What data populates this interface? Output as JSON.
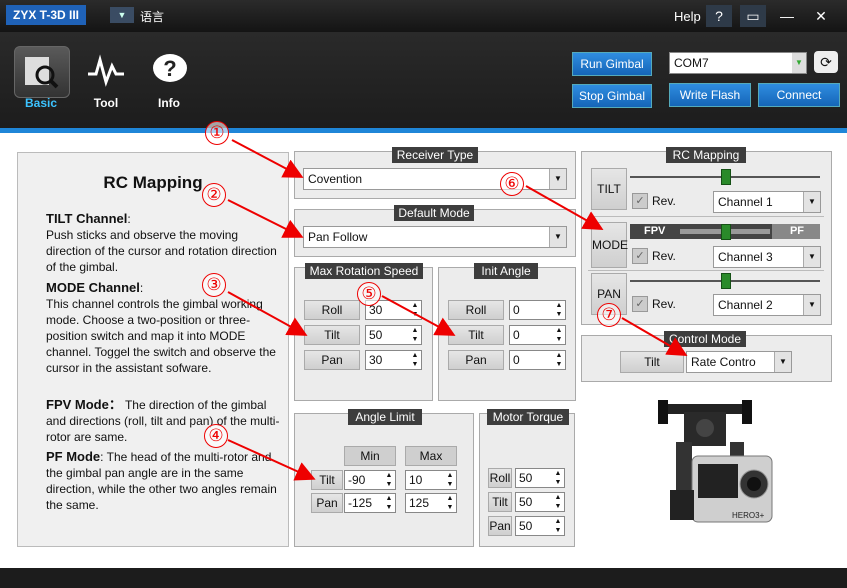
{
  "app": {
    "title": "ZYX T-3D III",
    "language_label": "语言",
    "help_label": "Help"
  },
  "toolbar": {
    "basic": "Basic",
    "tool": "Tool",
    "info": "Info",
    "run_gimbal": "Run Gimbal",
    "stop_gimbal": "Stop Gimbal",
    "write_flash": "Write Flash",
    "connect": "Connect",
    "com_port": "COM7"
  },
  "instructions": {
    "title": "RC Mapping",
    "tilt_head": "TILT Channel",
    "tilt_text": "Push sticks and observe the moving direction of the cursor and rotation direction of the gimbal.",
    "mode_head": "MODE Channel",
    "mode_text": "This channel controls the gimbal working mode. Choose a two-position or three-position switch and map it into MODE channel. Toggel the switch and observe the cursor in the assistant sofware.",
    "fpv_head": "FPV Mode：",
    "fpv_text": "The direction of the gimbal and directions (roll, tilt and pan) of the multi-rotor are same.",
    "pf_head": "PF Mode",
    "pf_text": "The head of the multi-rotor and the gimbal pan angle are in the same direction, while the other two angles remain the same."
  },
  "receiver": {
    "title": "Receiver Type",
    "value": "Covention"
  },
  "default_mode": {
    "title": "Default Mode",
    "value": "Pan Follow"
  },
  "max_speed": {
    "title": "Max Rotation Speed",
    "roll_label": "Roll",
    "roll": "30",
    "tilt_label": "Tilt",
    "tilt": "50",
    "pan_label": "Pan",
    "pan": "30"
  },
  "init_angle": {
    "title": "Init Angle",
    "roll_label": "Roll",
    "roll": "0",
    "tilt_label": "Tilt",
    "tilt": "0",
    "pan_label": "Pan",
    "pan": "0"
  },
  "angle_limit": {
    "title": "Angle Limit",
    "min_label": "Min",
    "max_label": "Max",
    "tilt_label": "Tilt",
    "tilt_min": "-90",
    "tilt_max": "10",
    "pan_label": "Pan",
    "pan_min": "-125",
    "pan_max": "125"
  },
  "motor_torque": {
    "title": "Motor Torque",
    "roll_label": "Roll",
    "roll": "50",
    "tilt_label": "Tilt",
    "tilt": "50",
    "pan_label": "Pan",
    "pan": "50"
  },
  "rc_mapping": {
    "title": "RC Mapping",
    "tilt_label": "TILT",
    "mode_label": "MODE",
    "pan_label": "PAN",
    "rev_label": "Rev.",
    "tilt_channel": "Channel 1",
    "mode_channel": "Channel 3",
    "pan_channel": "Channel 2",
    "fpv_label": "FPV",
    "pf_label": "PF",
    "tilt_slider": 0.5,
    "mode_slider": 0.5,
    "pan_slider": 0.5
  },
  "control_mode": {
    "title": "Control Mode",
    "tilt_label": "Tilt",
    "value": "Rate Contro"
  },
  "callouts": [
    "①",
    "②",
    "③",
    "④",
    "⑤",
    "⑥",
    "⑦"
  ],
  "camera": {
    "brand": "HERO3+"
  }
}
